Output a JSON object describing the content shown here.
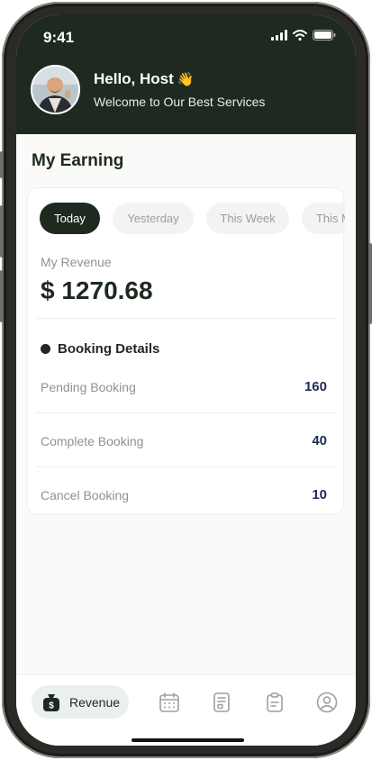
{
  "status_bar": {
    "time": "9:41"
  },
  "header": {
    "greeting": "Hello, Host",
    "greeting_emoji": "👋",
    "subtitle": "Welcome to Our Best Services",
    "avatar_icon": "user-avatar-photo"
  },
  "earning": {
    "title": "My Earning",
    "filters": [
      {
        "label": "Today",
        "active": true
      },
      {
        "label": "Yesterday",
        "active": false
      },
      {
        "label": "This Week",
        "active": false
      },
      {
        "label": "This Month",
        "active": false
      }
    ],
    "revenue_label": "My Revenue",
    "revenue_value": "$ 1270.68"
  },
  "booking_details": {
    "title": "Booking Details",
    "rows": [
      {
        "label": "Pending Booking",
        "value": "160"
      },
      {
        "label": "Complete Booking",
        "value": "40"
      },
      {
        "label": "Cancel Booking",
        "value": "10"
      }
    ]
  },
  "bottom_nav": {
    "active_label": "Revenue",
    "items": [
      {
        "icon": "revenue-bag-icon"
      },
      {
        "icon": "calendar-icon"
      },
      {
        "icon": "document-icon"
      },
      {
        "icon": "clipboard-icon"
      },
      {
        "icon": "profile-icon"
      }
    ]
  },
  "colors": {
    "brand_dark": "#1e2a1f",
    "value_navy": "#1f2a52",
    "muted_text": "#8e938f",
    "screen_bg": "#fafbf9"
  }
}
